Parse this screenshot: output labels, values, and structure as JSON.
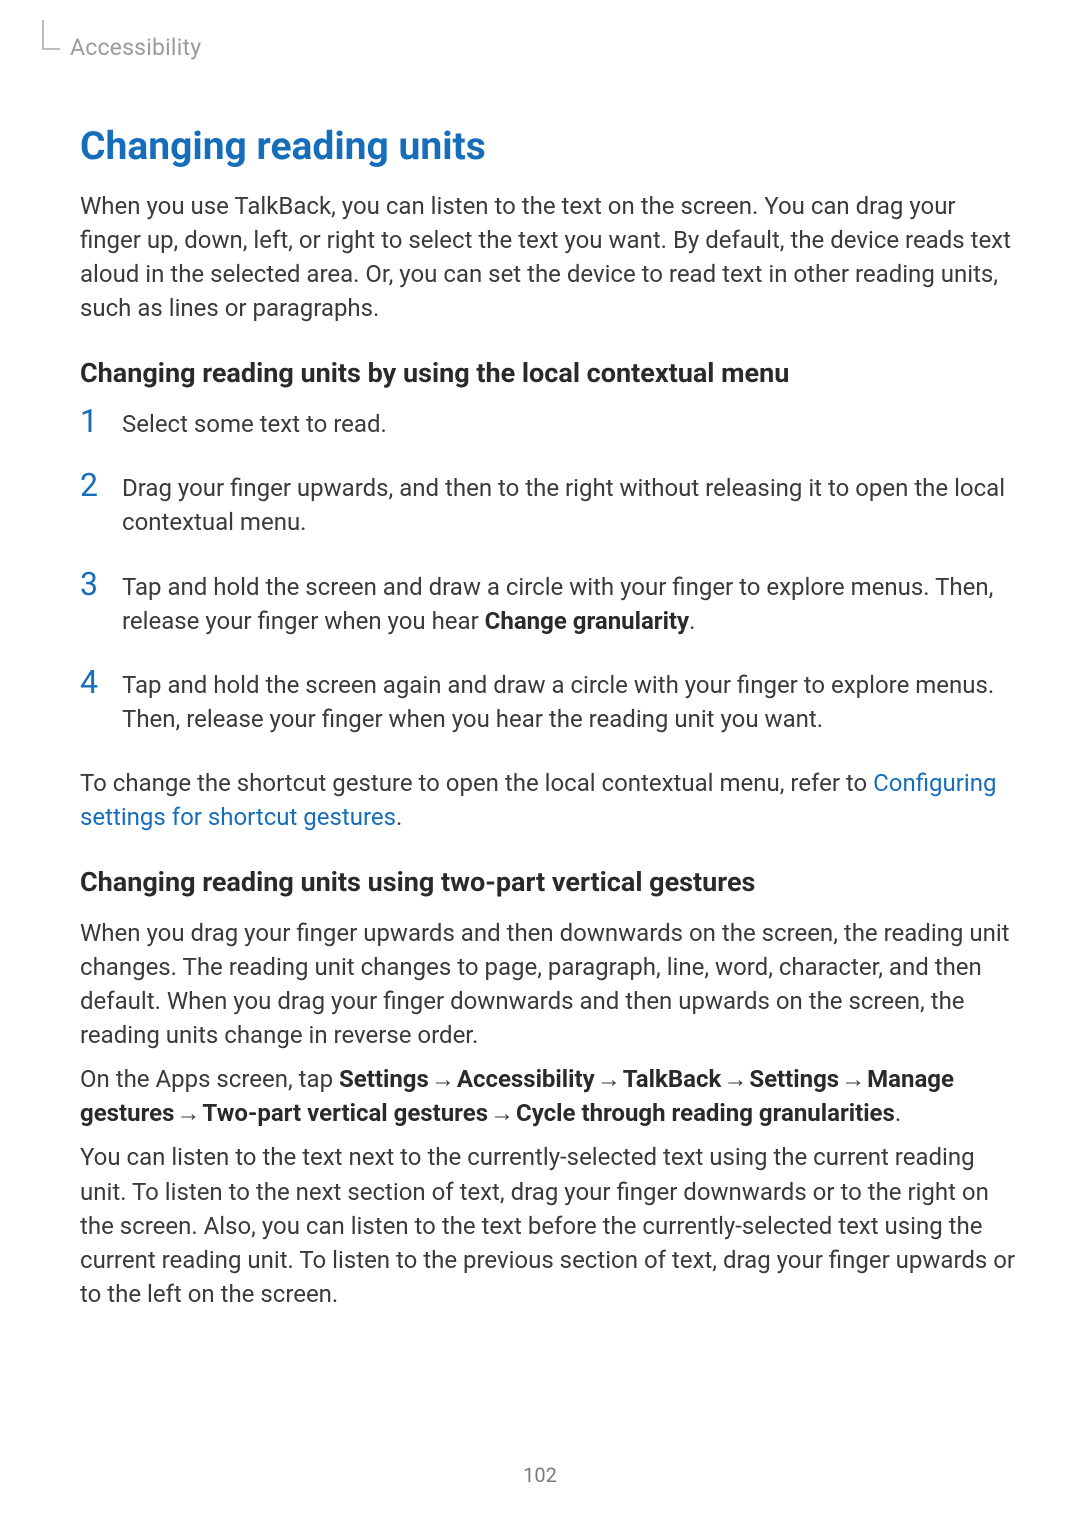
{
  "breadcrumb": "Accessibility",
  "section_title": "Changing reading units",
  "intro": "When you use TalkBack, you can listen to the text on the screen. You can drag your finger up, down, left, or right to select the text you want. By default, the device reads text aloud in the selected area. Or, you can set the device to read text in other reading units, such as lines or paragraphs.",
  "sub1_heading": "Changing reading units by using the local contextual menu",
  "steps": [
    {
      "pre": "Select some text to read."
    },
    {
      "pre": "Drag your finger upwards, and then to the right without releasing it to open the local contextual menu."
    },
    {
      "pre": "Tap and hold the screen and draw a circle with your finger to explore menus. Then, release your finger when you hear ",
      "bold": "Change granularity",
      "post": "."
    },
    {
      "pre": "Tap and hold the screen again and draw a circle with your finger to explore menus. Then, release your finger when you hear the reading unit you want."
    }
  ],
  "shortcut_pre": "To change the shortcut gesture to open the local contextual menu, refer to ",
  "shortcut_link": "Configuring settings for shortcut gestures",
  "shortcut_post": ".",
  "sub2_heading": "Changing reading units using two-part vertical gestures",
  "sub2_p1": "When you drag your finger upwards and then downwards on the screen, the reading unit changes. The reading unit changes to page, paragraph, line, word, character, and then default. When you drag your finger downwards and then upwards on the screen, the reading units change in reverse order.",
  "nav": {
    "pre": "On the Apps screen, tap ",
    "parts": [
      "Settings",
      "Accessibility",
      "TalkBack",
      "Settings",
      "Manage gestures",
      "Two-part vertical gestures",
      "Cycle through reading granularities"
    ],
    "arrow": "→",
    "post": "."
  },
  "sub2_p3": "You can listen to the text next to the currently-selected text using the current reading unit. To listen to the next section of text, drag your finger downwards or to the right on the screen. Also, you can listen to the text before the currently-selected text using the current reading unit. To listen to the previous section of text, drag your finger upwards or to the left on the screen.",
  "page_number": "102"
}
